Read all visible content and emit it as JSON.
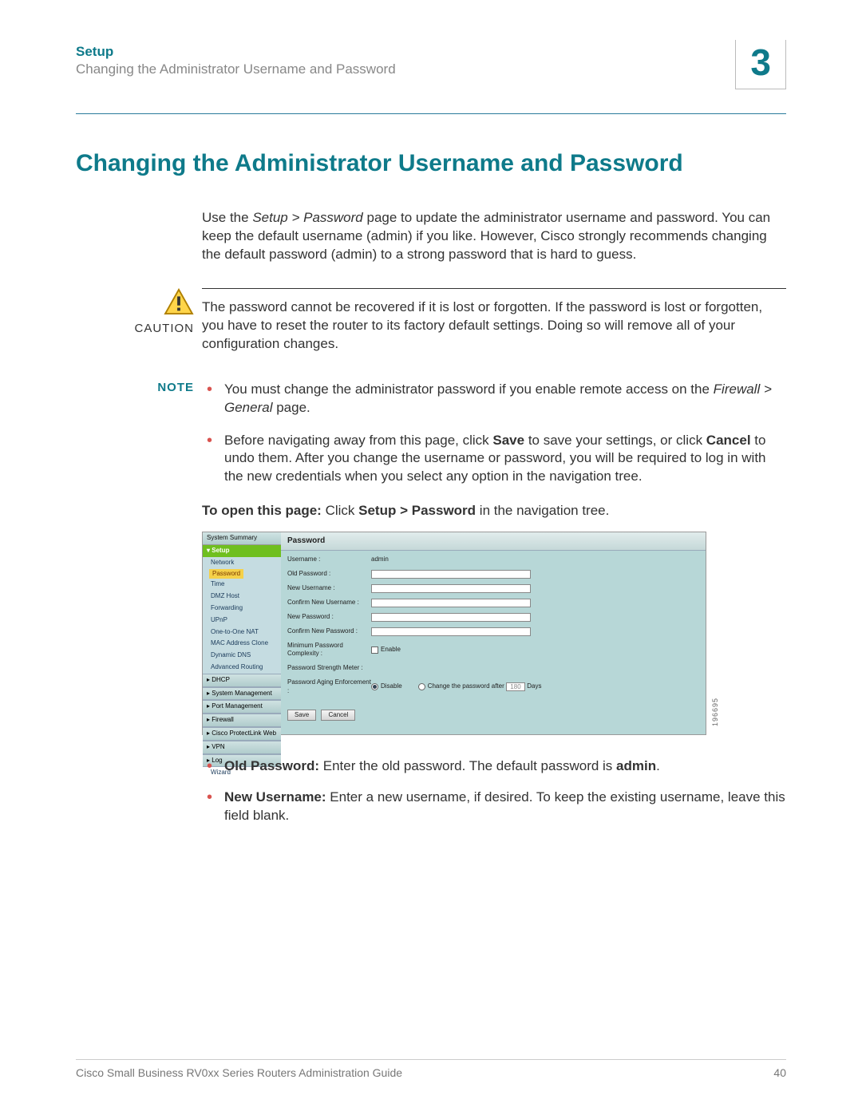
{
  "header": {
    "section": "Setup",
    "subtitle": "Changing the Administrator Username and Password",
    "chapter": "3"
  },
  "title": "Changing the Administrator Username and Password",
  "intro": {
    "pre": "Use the ",
    "path": "Setup > Password",
    "post": " page to update the administrator username and password. You can keep the default username (admin) if you like. However, Cisco strongly recommends changing the default password (admin) to a strong password that is hard to guess."
  },
  "caution": {
    "label": "CAUTION",
    "text": "The password cannot be recovered if it is lost or forgotten. If the password is lost or forgotten, you have to reset the router to its factory default settings. Doing so will remove all of your configuration changes."
  },
  "note": {
    "label": "NOTE",
    "items": [
      {
        "pre": "You must change the administrator password if you enable remote access on the ",
        "path": "Firewall > General",
        "post": " page."
      },
      {
        "pre": "Before navigating away from this page, click ",
        "b1": "Save",
        "mid1": " to save your settings, or click ",
        "b2": "Cancel",
        "post": " to undo them. After you change the username or password, you will be required to log in with the new credentials when you select any option in the navigation tree."
      }
    ]
  },
  "open_page": {
    "lead": "To open this page:",
    "pre": " Click ",
    "path": "Setup > Password",
    "post": " in the navigation tree."
  },
  "screenshot": {
    "image_id": "196695",
    "sidebar": {
      "top_tab": "System Summary",
      "active_group": "Setup",
      "setup_items": [
        "Network",
        "Password",
        "Time",
        "DMZ Host",
        "Forwarding",
        "UPnP",
        "One-to-One NAT",
        "MAC Address Clone",
        "Dynamic DNS",
        "Advanced Routing"
      ],
      "groups": [
        "DHCP",
        "System Management",
        "Port Management",
        "Firewall",
        "Cisco ProtectLink Web",
        "VPN",
        "Log",
        "Wizard"
      ]
    },
    "panel": {
      "title": "Password",
      "username_label": "Username :",
      "username_value": "admin",
      "old_pw_label": "Old Password :",
      "new_user_label": "New Username :",
      "confirm_user_label": "Confirm New Username :",
      "new_pw_label": "New Password :",
      "confirm_pw_label": "Confirm New Password :",
      "min_complexity_label": "Minimum Password Complexity :",
      "enable": "Enable",
      "strength_label": "Password Strength Meter :",
      "aging_label": "Password Aging Enforcement :",
      "disable": "Disable",
      "change_after_pre": "Change the password after",
      "change_after_days_value": "180",
      "days": "Days",
      "save": "Save",
      "cancel": "Cancel"
    }
  },
  "fields": [
    {
      "name": "Old Password:",
      "desc_pre": " Enter the old password. The default password is ",
      "desc_bold": "admin",
      "desc_post": "."
    },
    {
      "name": "New Username:",
      "desc_pre": " Enter a new username, if desired. To keep the existing username, leave this field blank.",
      "desc_bold": "",
      "desc_post": ""
    }
  ],
  "footer": {
    "title": "Cisco Small Business RV0xx Series Routers Administration Guide",
    "page": "40"
  }
}
